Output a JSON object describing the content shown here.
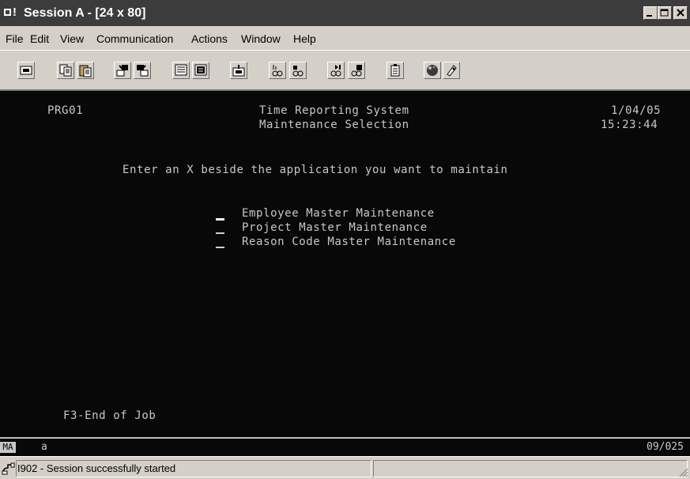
{
  "window": {
    "title": "Session A - [24 x 80]",
    "buttons": [
      "minimize",
      "maximize",
      "close"
    ]
  },
  "menu": [
    "File",
    "Edit",
    "View",
    "Communication",
    "Actions",
    "Window",
    "Help"
  ],
  "toolbar": {
    "icons": [
      "print-screen-icon",
      "copy-icon",
      "paste-icon",
      "send-file-icon",
      "receive-file-icon",
      "display-settings-icon",
      "keyboard-map-icon",
      "macro-icon",
      "record-macro-icon",
      "play-macro-icon",
      "stop-macro-icon",
      "run-macro-icon",
      "clipboard-icon",
      "palette-icon",
      "support-icon"
    ]
  },
  "terminal": {
    "program": "PRG01",
    "system_title": "Time Reporting System",
    "screen_title": "Maintenance Selection",
    "date": "1/04/05",
    "time": "15:23:44",
    "instruction": "Enter an X beside the application you want to maintain",
    "options": [
      {
        "label": "Employee Master Maintenance",
        "value": ""
      },
      {
        "label": "Project Master Maintenance",
        "value": ""
      },
      {
        "label": "Reason Code Master Maintenance",
        "value": ""
      }
    ],
    "function_keys": "F3-End of Job"
  },
  "oia": {
    "tag": "MA",
    "indicator": "a",
    "cursor_position": "09/025"
  },
  "status": {
    "message": "I902 - Session successfully started"
  }
}
